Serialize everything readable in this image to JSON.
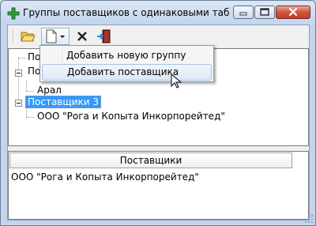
{
  "window": {
    "title": "Группы поставщиков с одинаковыми таблиц..."
  },
  "toolbar": {
    "buttons": [
      "open-folder",
      "new-document",
      "delete",
      "exit"
    ]
  },
  "tree": {
    "items": [
      {
        "label": "Пос",
        "level": 0,
        "expandable": false
      },
      {
        "label": "Пос",
        "level": 0,
        "expandable": true
      },
      {
        "label": "Арал",
        "level": 1,
        "expandable": false
      },
      {
        "label": "Поставщики 3",
        "level": 0,
        "expandable": true,
        "selected": true
      },
      {
        "label": "ООО \"Рога и Копыта Инкорпорейтед\"",
        "level": 1,
        "expandable": false
      }
    ]
  },
  "grid": {
    "header": "Поставщики",
    "rows": [
      "ООО \"Рога и Копыта Инкорпорейтед\""
    ]
  },
  "context_menu": {
    "items": [
      {
        "label": "Добавить новую группу",
        "hover": false
      },
      {
        "label": "Добавить поставщика",
        "hover": true
      }
    ]
  },
  "colors": {
    "selection": "#3399ff",
    "title_gradient_top": "#dbe7f5",
    "close_button": "#c13d2a"
  }
}
